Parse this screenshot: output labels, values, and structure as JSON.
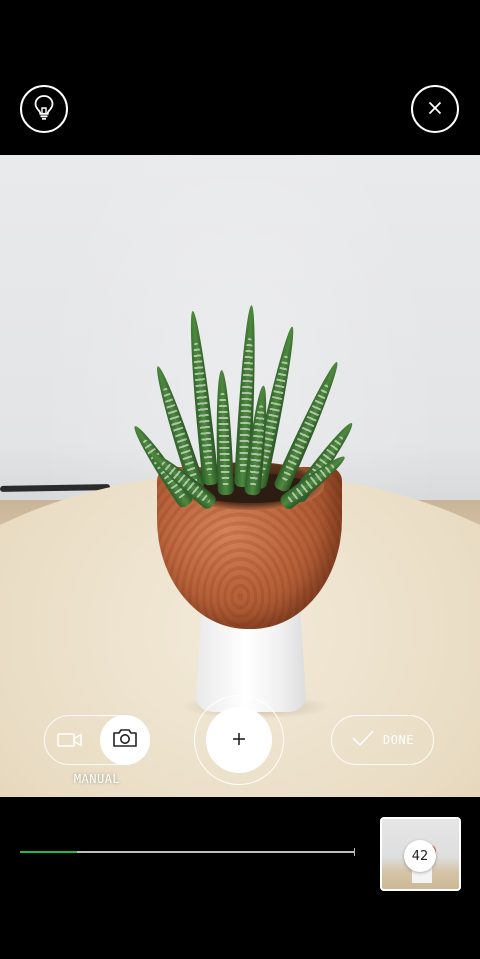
{
  "top_bar": {
    "tips_icon": "lightbulb-icon",
    "close_icon": "close-icon"
  },
  "controls": {
    "mode": {
      "label": "MANUAL",
      "video_icon": "video-camera-icon",
      "photo_icon": "camera-icon",
      "selected": "photo"
    },
    "capture_icon": "plus-icon",
    "done_label": "DONE",
    "done_icon": "checkmark-icon"
  },
  "capture_progress": {
    "fraction": 0.17,
    "fill_color": "#1db954"
  },
  "thumbnail": {
    "count": "42"
  }
}
